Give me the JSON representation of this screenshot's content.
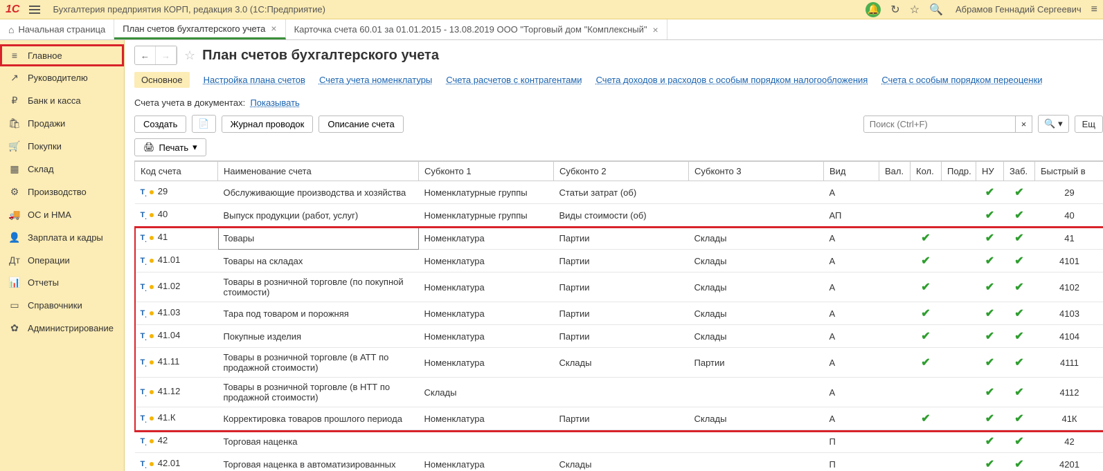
{
  "titlebar": {
    "app_title": "Бухгалтерия предприятия КОРП, редакция 3.0  (1С:Предприятие)",
    "user": "Абрамов Геннадий Сергеевич"
  },
  "tabs": [
    {
      "label": "Начальная страница"
    },
    {
      "label": "План счетов бухгалтерского учета",
      "active": true,
      "closable": true
    },
    {
      "label": "Карточка счета 60.01 за 01.01.2015 - 13.08.2019 ООО \"Торговый дом \"Комплексный\"",
      "closable": true
    }
  ],
  "sidebar": [
    {
      "icon": "≡",
      "label": "Главное",
      "selected": true
    },
    {
      "icon": "↗",
      "label": "Руководителю"
    },
    {
      "icon": "₽",
      "label": "Банк и касса"
    },
    {
      "icon": "🛍",
      "label": "Продажи"
    },
    {
      "icon": "🛒",
      "label": "Покупки"
    },
    {
      "icon": "▦",
      "label": "Склад"
    },
    {
      "icon": "⚙",
      "label": "Производство"
    },
    {
      "icon": "🚚",
      "label": "ОС и НМА"
    },
    {
      "icon": "👤",
      "label": "Зарплата и кадры"
    },
    {
      "icon": "Дт",
      "label": "Операции"
    },
    {
      "icon": "📊",
      "label": "Отчеты"
    },
    {
      "icon": "▭",
      "label": "Справочники"
    },
    {
      "icon": "✿",
      "label": "Администрирование"
    }
  ],
  "page": {
    "title": "План счетов бухгалтерского учета",
    "subnav": [
      {
        "label": "Основное",
        "active": true
      },
      {
        "label": "Настройка плана счетов"
      },
      {
        "label": "Счета учета номенклатуры"
      },
      {
        "label": "Счета расчетов с контрагентами"
      },
      {
        "label": "Счета доходов и расходов с особым порядком налогообложения"
      },
      {
        "label": "Счета с особым порядком переоценки"
      }
    ],
    "docs_label": "Счета учета в документах:",
    "docs_link": "Показывать",
    "toolbar": {
      "create": "Создать",
      "journal": "Журнал проводок",
      "desc": "Описание счета",
      "search_ph": "Поиск (Ctrl+F)",
      "more": "Ещ",
      "print": "Печать"
    },
    "columns": [
      "Код счета",
      "Наименование счета",
      "Субконто 1",
      "Субконто 2",
      "Субконто 3",
      "Вид",
      "Вал.",
      "Кол.",
      "Подр.",
      "НУ",
      "Заб.",
      "Быстрый в"
    ],
    "rows": [
      {
        "code": "29",
        "name": "Обслуживающие производства и хозяйства",
        "s1": "Номенклатурные группы",
        "s2": "Статьи затрат (об)",
        "s3": "",
        "vid": "А",
        "nu": true,
        "zab": true,
        "fast": "29"
      },
      {
        "code": "40",
        "name": "Выпуск продукции (работ, услуг)",
        "s1": "Номенклатурные группы",
        "s2": "Виды стоимости (об)",
        "s3": "",
        "vid": "АП",
        "nu": true,
        "zab": true,
        "fast": "40"
      },
      {
        "code": "41",
        "name": "Товары",
        "s1": "Номенклатура",
        "s2": "Партии",
        "s3": "Склады",
        "vid": "А",
        "kol": true,
        "nu": true,
        "zab": true,
        "fast": "41",
        "hl": true,
        "sel": true
      },
      {
        "code": "41.01",
        "name": "Товары на складах",
        "s1": "Номенклатура",
        "s2": "Партии",
        "s3": "Склады",
        "vid": "А",
        "kol": true,
        "nu": true,
        "zab": true,
        "fast": "4101",
        "hl": true
      },
      {
        "code": "41.02",
        "name": "Товары в розничной торговле (по покупной стоимости)",
        "s1": "Номенклатура",
        "s2": "Партии",
        "s3": "Склады",
        "vid": "А",
        "kol": true,
        "nu": true,
        "zab": true,
        "fast": "4102",
        "hl": true
      },
      {
        "code": "41.03",
        "name": "Тара под товаром и порожняя",
        "s1": "Номенклатура",
        "s2": "Партии",
        "s3": "Склады",
        "vid": "А",
        "kol": true,
        "nu": true,
        "zab": true,
        "fast": "4103",
        "hl": true
      },
      {
        "code": "41.04",
        "name": "Покупные изделия",
        "s1": "Номенклатура",
        "s2": "Партии",
        "s3": "Склады",
        "vid": "А",
        "kol": true,
        "nu": true,
        "zab": true,
        "fast": "4104",
        "hl": true
      },
      {
        "code": "41.11",
        "name": "Товары в розничной торговле (в АТТ по продажной стоимости)",
        "s1": "Номенклатура",
        "s2": "Склады",
        "s3": "Партии",
        "vid": "А",
        "kol": true,
        "nu": true,
        "zab": true,
        "fast": "4111",
        "hl": true
      },
      {
        "code": "41.12",
        "name": "Товары в розничной торговле (в НТТ по продажной стоимости)",
        "s1": "Склады",
        "s2": "",
        "s3": "",
        "vid": "А",
        "nu": true,
        "zab": true,
        "fast": "4112",
        "hl": true
      },
      {
        "code": "41.К",
        "name": "Корректировка товаров прошлого периода",
        "s1": "Номенклатура",
        "s2": "Партии",
        "s3": "Склады",
        "vid": "А",
        "kol": true,
        "nu": true,
        "zab": true,
        "fast": "41К",
        "hl": true
      },
      {
        "code": "42",
        "name": "Торговая наценка",
        "s1": "",
        "s2": "",
        "s3": "",
        "vid": "П",
        "nu": true,
        "zab": true,
        "fast": "42"
      },
      {
        "code": "42.01",
        "name": "Торговая наценка в автоматизированных",
        "s1": "Номенклатура",
        "s2": "Склады",
        "s3": "",
        "vid": "П",
        "nu": true,
        "zab": true,
        "fast": "4201"
      }
    ]
  }
}
